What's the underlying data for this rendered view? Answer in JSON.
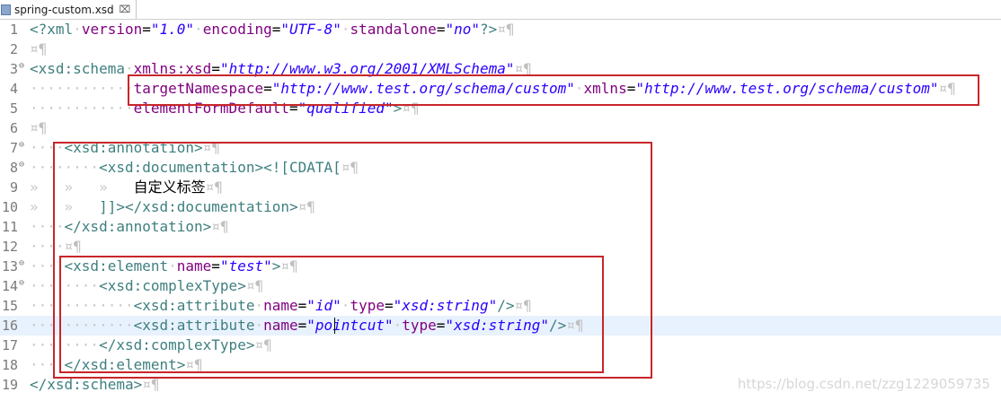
{
  "tab": {
    "title": "spring-custom.xsd",
    "close_glyph": "⌧"
  },
  "editor": {
    "current_line": 16,
    "lines": [
      {
        "num": "1",
        "fold": false,
        "segments": [
          {
            "t": "tg",
            "s": "<?xml"
          },
          {
            "t": "ws",
            "s": "·"
          },
          {
            "t": "an",
            "s": "version"
          },
          {
            "t": "pl",
            "s": "="
          },
          {
            "t": "av",
            "s": "\"1.0\""
          },
          {
            "t": "ws",
            "s": "·"
          },
          {
            "t": "an",
            "s": "encoding"
          },
          {
            "t": "pl",
            "s": "="
          },
          {
            "t": "av",
            "s": "\"UTF-8\""
          },
          {
            "t": "ws",
            "s": "·"
          },
          {
            "t": "an",
            "s": "standalone"
          },
          {
            "t": "pl",
            "s": "="
          },
          {
            "t": "av",
            "s": "\"no\""
          },
          {
            "t": "tg",
            "s": "?>"
          },
          {
            "t": "mk",
            "s": "¤¶"
          }
        ]
      },
      {
        "num": "2",
        "fold": false,
        "segments": [
          {
            "t": "mk",
            "s": "¤¶"
          }
        ]
      },
      {
        "num": "3",
        "fold": true,
        "segments": [
          {
            "t": "tg",
            "s": "<xsd:schema"
          },
          {
            "t": "ws",
            "s": "·"
          },
          {
            "t": "an",
            "s": "xmlns:xsd"
          },
          {
            "t": "pl",
            "s": "="
          },
          {
            "t": "av",
            "s": "\"http://www.w3.org/2001/XMLSchema\""
          },
          {
            "t": "mk",
            "s": "¤¶"
          }
        ]
      },
      {
        "num": "4",
        "fold": false,
        "segments": [
          {
            "t": "ws",
            "s": "············"
          },
          {
            "t": "an",
            "s": "targetNamespace"
          },
          {
            "t": "pl",
            "s": "="
          },
          {
            "t": "av",
            "s": "\"http://www.test.org/schema/custom\""
          },
          {
            "t": "ws",
            "s": "·"
          },
          {
            "t": "an",
            "s": "xmlns"
          },
          {
            "t": "pl",
            "s": "="
          },
          {
            "t": "av",
            "s": "\"http://www.test.org/schema/custom\""
          },
          {
            "t": "mk",
            "s": "¤¶"
          }
        ]
      },
      {
        "num": "5",
        "fold": false,
        "segments": [
          {
            "t": "ws",
            "s": "············"
          },
          {
            "t": "an",
            "s": "elementFormDefault"
          },
          {
            "t": "pl",
            "s": "="
          },
          {
            "t": "av",
            "s": "\"qualified\""
          },
          {
            "t": "tg",
            "s": ">"
          },
          {
            "t": "mk",
            "s": "¤¶"
          }
        ]
      },
      {
        "num": "6",
        "fold": false,
        "segments": [
          {
            "t": "mk",
            "s": "¤¶"
          }
        ]
      },
      {
        "num": "7",
        "fold": true,
        "segments": [
          {
            "t": "ws",
            "s": "····"
          },
          {
            "t": "tg",
            "s": "<xsd:annotation>"
          },
          {
            "t": "mk",
            "s": "¤¶"
          }
        ]
      },
      {
        "num": "8",
        "fold": true,
        "segments": [
          {
            "t": "ws",
            "s": "········"
          },
          {
            "t": "tg",
            "s": "<xsd:documentation>"
          },
          {
            "t": "tg",
            "s": "<![CDATA["
          },
          {
            "t": "mk",
            "s": "¤¶"
          }
        ]
      },
      {
        "num": "9",
        "fold": false,
        "segments": [
          {
            "t": "ws",
            "s": "»   »   »   "
          },
          {
            "t": "pl cjk",
            "s": "自定义标签"
          },
          {
            "t": "mk",
            "s": "¤¶"
          }
        ]
      },
      {
        "num": "10",
        "fold": false,
        "segments": [
          {
            "t": "ws",
            "s": "»   »   "
          },
          {
            "t": "tg",
            "s": "]]>"
          },
          {
            "t": "tg",
            "s": "</xsd:documentation>"
          },
          {
            "t": "mk",
            "s": "¤¶"
          }
        ]
      },
      {
        "num": "11",
        "fold": false,
        "segments": [
          {
            "t": "ws",
            "s": "····"
          },
          {
            "t": "tg",
            "s": "</xsd:annotation>"
          },
          {
            "t": "mk",
            "s": "¤¶"
          }
        ]
      },
      {
        "num": "12",
        "fold": false,
        "segments": [
          {
            "t": "ws",
            "s": "····"
          },
          {
            "t": "mk",
            "s": "¤¶"
          }
        ]
      },
      {
        "num": "13",
        "fold": true,
        "segments": [
          {
            "t": "ws",
            "s": "····"
          },
          {
            "t": "tg",
            "s": "<xsd:element"
          },
          {
            "t": "ws",
            "s": "·"
          },
          {
            "t": "an",
            "s": "name"
          },
          {
            "t": "pl",
            "s": "="
          },
          {
            "t": "av",
            "s": "\"test\""
          },
          {
            "t": "tg",
            "s": ">"
          },
          {
            "t": "mk",
            "s": "¤¶"
          }
        ]
      },
      {
        "num": "14",
        "fold": true,
        "segments": [
          {
            "t": "ws",
            "s": "········"
          },
          {
            "t": "tg",
            "s": "<xsd:complexType>"
          },
          {
            "t": "mk",
            "s": "¤¶"
          }
        ]
      },
      {
        "num": "15",
        "fold": false,
        "segments": [
          {
            "t": "ws",
            "s": "············"
          },
          {
            "t": "tg",
            "s": "<xsd:attribute"
          },
          {
            "t": "ws",
            "s": "·"
          },
          {
            "t": "an",
            "s": "name"
          },
          {
            "t": "pl",
            "s": "="
          },
          {
            "t": "av",
            "s": "\"id\""
          },
          {
            "t": "ws",
            "s": "·"
          },
          {
            "t": "an",
            "s": "type"
          },
          {
            "t": "pl",
            "s": "="
          },
          {
            "t": "av",
            "s": "\"xsd:string\""
          },
          {
            "t": "tg",
            "s": "/>"
          },
          {
            "t": "mk",
            "s": "¤¶"
          }
        ]
      },
      {
        "num": "16",
        "fold": false,
        "segments": [
          {
            "t": "ws",
            "s": "············"
          },
          {
            "t": "tg",
            "s": "<xsd:attribute"
          },
          {
            "t": "ws",
            "s": "·"
          },
          {
            "t": "an",
            "s": "name"
          },
          {
            "t": "pl",
            "s": "="
          },
          {
            "t": "av",
            "s": "\"pointcut\""
          },
          {
            "t": "ws",
            "s": "·"
          },
          {
            "t": "an",
            "s": "type"
          },
          {
            "t": "pl",
            "s": "="
          },
          {
            "t": "av",
            "s": "\"xsd:string\""
          },
          {
            "t": "tg",
            "s": "/>"
          },
          {
            "t": "mk",
            "s": "¤¶"
          }
        ]
      },
      {
        "num": "17",
        "fold": false,
        "segments": [
          {
            "t": "ws",
            "s": "········"
          },
          {
            "t": "tg",
            "s": "</xsd:complexType>"
          },
          {
            "t": "mk",
            "s": "¤¶"
          }
        ]
      },
      {
        "num": "18",
        "fold": false,
        "segments": [
          {
            "t": "ws",
            "s": "····"
          },
          {
            "t": "tg",
            "s": "</xsd:element>"
          },
          {
            "t": "mk",
            "s": "¤¶"
          }
        ]
      },
      {
        "num": "19",
        "fold": false,
        "segments": [
          {
            "t": "tg",
            "s": "</xsd:schema>"
          },
          {
            "t": "mk",
            "s": "¤¶"
          }
        ]
      }
    ]
  },
  "highlight_color": "#c8262a",
  "watermark": "https://blog.csdn.net/zzg1229059735"
}
